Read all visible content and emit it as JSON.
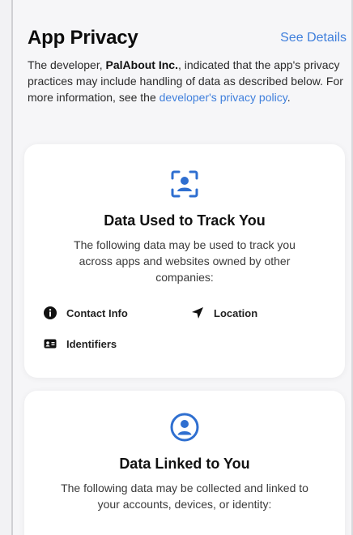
{
  "header": {
    "title": "App Privacy",
    "see_details": "See Details"
  },
  "intro": {
    "prefix": "The developer, ",
    "developer_name": "PalAbout Inc.",
    "middle": ", indicated that the app's privacy practices may include handling of data as described below. For more information, see the ",
    "link_text": "developer's privacy policy",
    "suffix": "."
  },
  "cards": [
    {
      "icon": "tracking-person-icon",
      "title": "Data Used to Track You",
      "description": "The following data may be used to track you across apps and websites owned by other companies:",
      "items": [
        {
          "icon": "info-circle-icon",
          "label": "Contact Info"
        },
        {
          "icon": "location-arrow-icon",
          "label": "Location"
        },
        {
          "icon": "id-card-icon",
          "label": "Identifiers"
        }
      ]
    },
    {
      "icon": "person-circle-icon",
      "title": "Data Linked to You",
      "description": "The following data may be collected and linked to your accounts, devices, or identity:"
    }
  ],
  "colors": {
    "accent": "#3f7fdc",
    "card_bg": "#ffffff",
    "page_bg": "#f6f6f8"
  }
}
